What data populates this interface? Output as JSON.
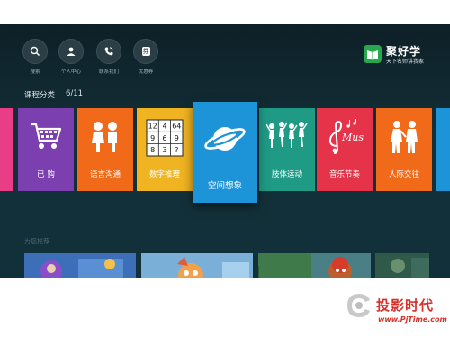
{
  "top_nav": [
    {
      "label": "搜索",
      "icon": "search-icon"
    },
    {
      "label": "个人中心",
      "icon": "user-icon"
    },
    {
      "label": "联系我们",
      "icon": "phone-icon"
    },
    {
      "label": "优惠券",
      "icon": "coupon-icon"
    }
  ],
  "coupon_glyph": "券",
  "brand": {
    "name": "聚好学",
    "slogan": "天下名师讲我家"
  },
  "category": {
    "title": "课程分类",
    "count": "6/11"
  },
  "tiles": [
    {
      "label": "",
      "color": "#e93d86",
      "icon": "partial-icon"
    },
    {
      "label": "已 购",
      "color": "#7b3fb0",
      "icon": "cart-icon"
    },
    {
      "label": "语言沟通",
      "color": "#f06a19",
      "icon": "kids-talk-icon"
    },
    {
      "label": "数字推理",
      "color": "#f0b422",
      "icon": "number-grid-icon"
    },
    {
      "label": "空间想象",
      "color": "#1d93d8",
      "icon": "planet-icon"
    },
    {
      "label": "肢体运动",
      "color": "#1f9a85",
      "icon": "dancers-icon"
    },
    {
      "label": "音乐节奏",
      "color": "#e5344a",
      "icon": "music-icon"
    },
    {
      "label": "人际交往",
      "color": "#f06a19",
      "icon": "people-icon"
    },
    {
      "label": "",
      "color": "#1d93d8",
      "icon": "partial-icon"
    }
  ],
  "grid_numbers": [
    "12",
    "4",
    "64",
    "9",
    "6",
    "9",
    "8",
    "3",
    "?"
  ],
  "music_text": "Music",
  "recommend_title": "为您推荐",
  "recommend_tiles": [
    {
      "color": "#3d6fb8",
      "icon": "cartoon-thumb"
    },
    {
      "color": "#7ab0d8",
      "icon": "cartoon-thumb"
    },
    {
      "color": "#3e7a4a",
      "icon": "cartoon-thumb"
    },
    {
      "color": "#b8612c",
      "icon": "cartoon-thumb"
    }
  ],
  "watermark": {
    "cn": "投影时代",
    "url": "www.PjTime.com"
  }
}
